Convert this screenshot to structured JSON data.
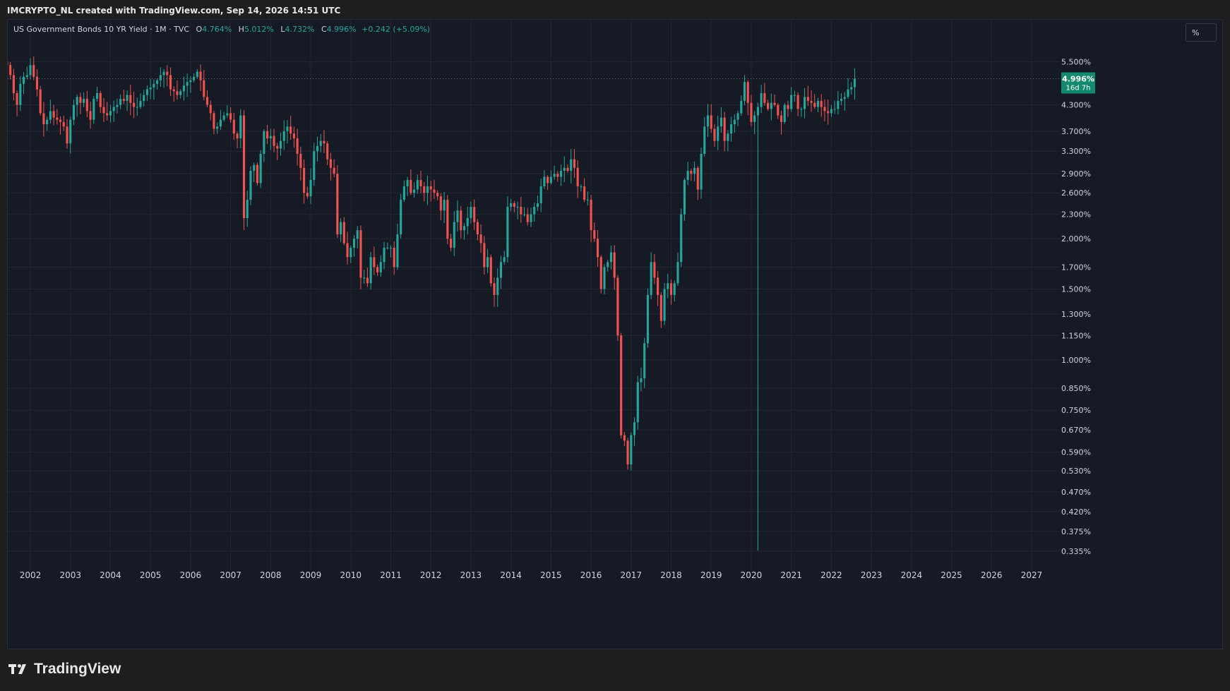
{
  "header": {
    "caption": "IMCRYPTO_NL created with TradingView.com, Sep 14, 2026 14:51 UTC"
  },
  "legend": {
    "symbol": "US Government Bonds 10 YR Yield · 1M · TVC",
    "open_key": "O",
    "open": "4.764%",
    "high_key": "H",
    "high": "5.012%",
    "low_key": "L",
    "low": "4.732%",
    "close_key": "C",
    "close": "4.996%",
    "change": "+0.242 (+5.09%)"
  },
  "scale_button": "%",
  "price_tag": {
    "price": "4.996%",
    "countdown": "16d 7h"
  },
  "brand": {
    "name": "TradingView"
  },
  "colors": {
    "up": "#26a69a",
    "down": "#ef5350",
    "background": "#161a25",
    "grid": "#232734",
    "tag": "#138a6f"
  },
  "chart_data": {
    "type": "candlestick",
    "interval": "1M",
    "yscale": "log",
    "ylim": [
      0.31,
      6.2
    ],
    "y_ticks": [
      "5.500%",
      "4.300%",
      "3.700%",
      "3.300%",
      "2.900%",
      "2.600%",
      "2.300%",
      "2.000%",
      "1.700%",
      "1.500%",
      "1.300%",
      "1.150%",
      "1.000%",
      "0.850%",
      "0.750%",
      "0.670%",
      "0.590%",
      "0.530%",
      "0.470%",
      "0.420%",
      "0.375%",
      "0.335%"
    ],
    "x_ticks": [
      "2002",
      "2003",
      "2004",
      "2005",
      "2006",
      "2007",
      "2008",
      "2009",
      "2010",
      "2011",
      "2012",
      "2013",
      "2014",
      "2015",
      "2016",
      "2017",
      "2018",
      "2019",
      "2020",
      "2021",
      "2022",
      "2023",
      "2024",
      "2025",
      "2026",
      "2027"
    ],
    "x_start": "2001-06",
    "last_price": 4.996,
    "series_close": [
      5.4,
      5.1,
      4.6,
      4.3,
      4.85,
      5.05,
      5.1,
      5.4,
      5.05,
      4.7,
      4.1,
      3.85,
      3.95,
      4.15,
      4.0,
      3.95,
      3.9,
      3.8,
      3.45,
      3.95,
      4.3,
      4.5,
      4.35,
      4.45,
      4.15,
      3.95,
      4.45,
      4.6,
      4.25,
      4.1,
      4.05,
      4.15,
      4.25,
      4.3,
      4.45,
      4.4,
      4.55,
      4.35,
      4.25,
      4.25,
      4.4,
      4.55,
      4.7,
      4.75,
      4.85,
      4.95,
      5.1,
      5.2,
      5.1,
      4.7,
      4.65,
      4.55,
      4.65,
      4.8,
      4.9,
      4.95,
      5.05,
      5.2,
      4.95,
      4.5,
      4.3,
      4.1,
      3.75,
      3.8,
      3.95,
      4.05,
      4.1,
      3.95,
      3.65,
      3.55,
      4.05,
      2.25,
      2.5,
      2.95,
      3.05,
      2.75,
      3.25,
      3.7,
      3.55,
      3.6,
      3.4,
      3.35,
      3.5,
      3.7,
      3.8,
      3.65,
      3.55,
      3.25,
      3.0,
      2.6,
      2.55,
      2.8,
      3.3,
      3.4,
      3.5,
      3.45,
      3.15,
      3.0,
      2.9,
      2.05,
      2.2,
      1.95,
      1.8,
      1.9,
      2.0,
      2.1,
      1.6,
      1.6,
      1.55,
      1.8,
      1.7,
      1.65,
      1.75,
      1.9,
      1.9,
      1.9,
      1.7,
      2.05,
      2.5,
      2.7,
      2.8,
      2.6,
      2.65,
      2.8,
      2.7,
      2.6,
      2.7,
      2.65,
      2.6,
      2.55,
      2.35,
      2.5,
      2.0,
      1.9,
      2.2,
      2.35,
      2.1,
      2.15,
      2.25,
      2.4,
      2.2,
      2.05,
      1.95,
      1.7,
      1.8,
      1.55,
      1.45,
      1.6,
      1.75,
      1.8,
      2.4,
      2.45,
      2.4,
      2.4,
      2.3,
      2.3,
      2.2,
      2.3,
      2.4,
      2.45,
      2.7,
      2.85,
      2.75,
      2.85,
      2.9,
      2.85,
      2.95,
      3.0,
      2.95,
      3.15,
      3.0,
      2.7,
      2.7,
      2.5,
      2.5,
      2.1,
      2.0,
      1.8,
      1.5,
      1.7,
      1.75,
      1.85,
      1.6,
      1.15,
      0.65,
      0.63,
      0.55,
      0.65,
      0.7,
      0.88,
      0.9,
      1.1,
      1.45,
      1.75,
      1.6,
      1.45,
      1.25,
      1.5,
      1.55,
      1.45,
      1.55,
      1.75,
      2.3,
      2.8,
      2.95,
      2.9,
      3.0,
      2.65,
      3.25,
      3.8,
      4.05,
      3.75,
      3.5,
      3.8,
      4.0,
      3.5,
      3.65,
      3.85,
      3.95,
      4.1,
      4.4,
      4.9,
      4.35,
      3.9,
      4.05,
      4.25,
      4.6,
      4.35,
      4.2,
      4.35,
      4.3,
      4.05,
      3.9,
      4.3,
      4.2,
      4.55,
      4.55,
      4.2,
      4.2,
      4.5,
      4.4,
      4.35,
      4.25,
      4.4,
      4.25,
      4.15,
      4.1,
      4.2,
      4.2,
      4.4,
      4.45,
      4.5,
      4.7,
      4.76,
      4.996
    ]
  }
}
